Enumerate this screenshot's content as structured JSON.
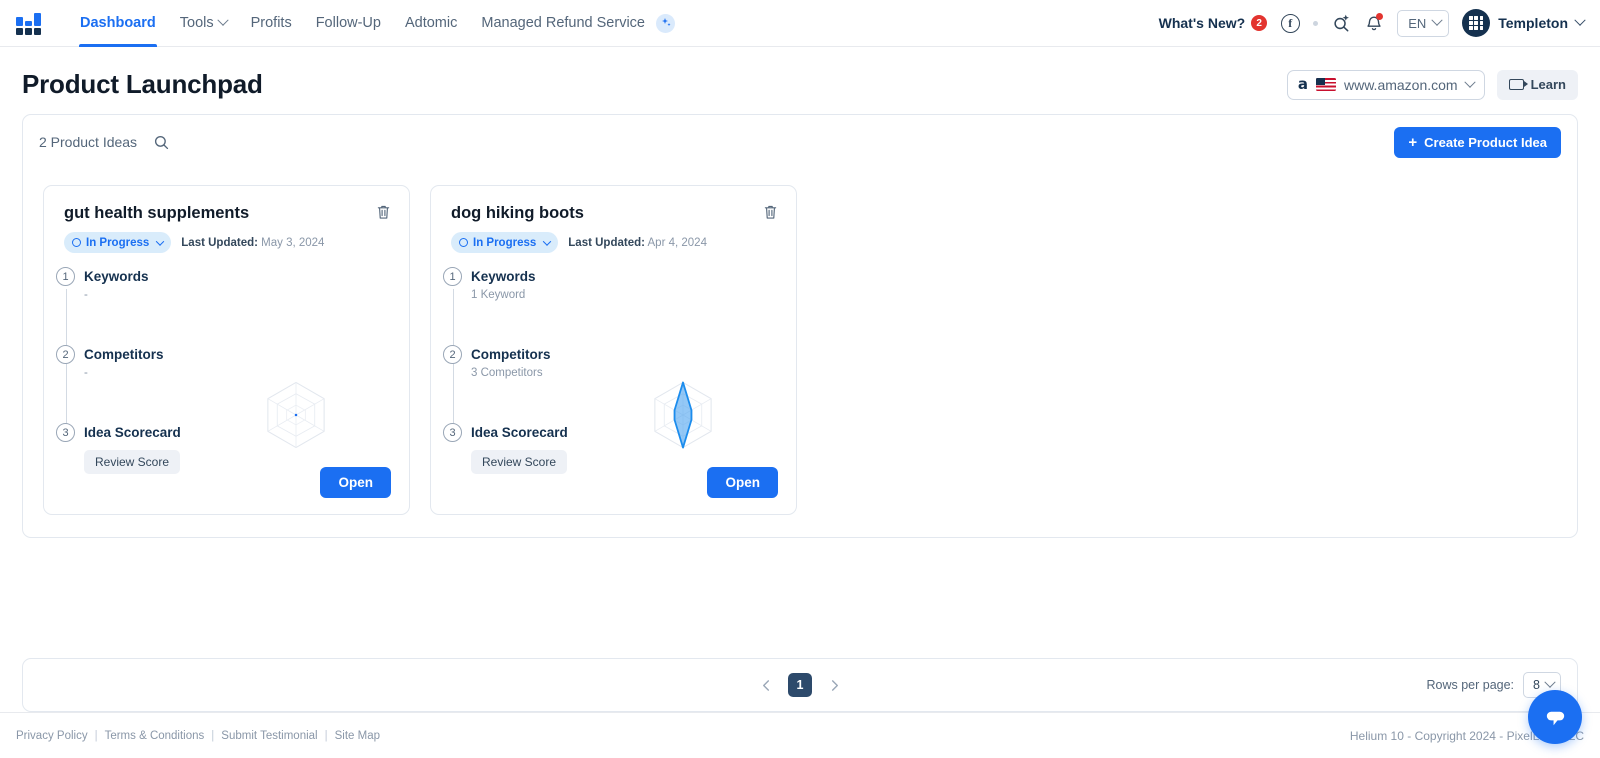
{
  "nav": {
    "logo_name": "helium10-logo",
    "links": [
      {
        "label": "Dashboard",
        "active": true,
        "caret": false
      },
      {
        "label": "Tools",
        "active": false,
        "caret": true
      },
      {
        "label": "Profits",
        "active": false,
        "caret": false
      },
      {
        "label": "Follow-Up",
        "active": false,
        "caret": false
      },
      {
        "label": "Adtomic",
        "active": false,
        "caret": false
      },
      {
        "label": "Managed Refund Service",
        "active": false,
        "caret": false,
        "badge": "ai-sparkle"
      }
    ],
    "whats_new": "What's New?",
    "whats_new_count": "2",
    "facebook_glyph": "f",
    "language": "EN",
    "user_name": "Templeton"
  },
  "header": {
    "title": "Product Launchpad",
    "marketplace": {
      "amazon_glyph": "a",
      "flag": "us-flag",
      "name": "www.amazon.com"
    },
    "learn_label": "Learn"
  },
  "toolbar": {
    "count_label": "2 Product Ideas",
    "search_placeholder": "Search",
    "create_label": "Create Product Idea",
    "plus_glyph": "+"
  },
  "cards": [
    {
      "title": "gut health supplements",
      "status": "In Progress",
      "updated_label": "Last Updated:",
      "updated_value": "May 3, 2024",
      "steps": [
        {
          "num": "1",
          "label": "Keywords",
          "sub": "-"
        },
        {
          "num": "2",
          "label": "Competitors",
          "sub": "-"
        },
        {
          "num": "3",
          "label": "Idea Scorecard",
          "sub": ""
        }
      ],
      "score_label": "Review Score",
      "open_label": "Open",
      "radar": {
        "values": [
          0,
          0,
          0,
          0,
          0,
          0
        ],
        "max": 10,
        "rings": 3,
        "axes": 6,
        "filled": false
      }
    },
    {
      "title": "dog hiking boots",
      "status": "In Progress",
      "updated_label": "Last Updated:",
      "updated_value": "Apr 4, 2024",
      "steps": [
        {
          "num": "1",
          "label": "Keywords",
          "sub": "1 Keyword"
        },
        {
          "num": "2",
          "label": "Competitors",
          "sub": "3 Competitors"
        },
        {
          "num": "3",
          "label": "Idea Scorecard",
          "sub": ""
        }
      ],
      "score_label": "Review Score",
      "open_label": "Open",
      "radar": {
        "values": [
          10,
          3,
          3,
          10,
          3,
          3
        ],
        "max": 10,
        "rings": 3,
        "axes": 6,
        "filled": true
      }
    }
  ],
  "pagination": {
    "current_page": "1",
    "rows_label": "Rows per page:",
    "rows_value": "8"
  },
  "footer": {
    "links": [
      "Privacy Policy",
      "Terms & Conditions",
      "Submit Testimonial",
      "Site Map"
    ],
    "separator": "|",
    "copyright": "Helium 10 - Copyright 2024 - PixelLabs LLC"
  },
  "colors": {
    "accent": "#1b6ff2",
    "navy": "#15314f",
    "danger": "#e3342f",
    "pill_bg": "#d9ecfb"
  }
}
